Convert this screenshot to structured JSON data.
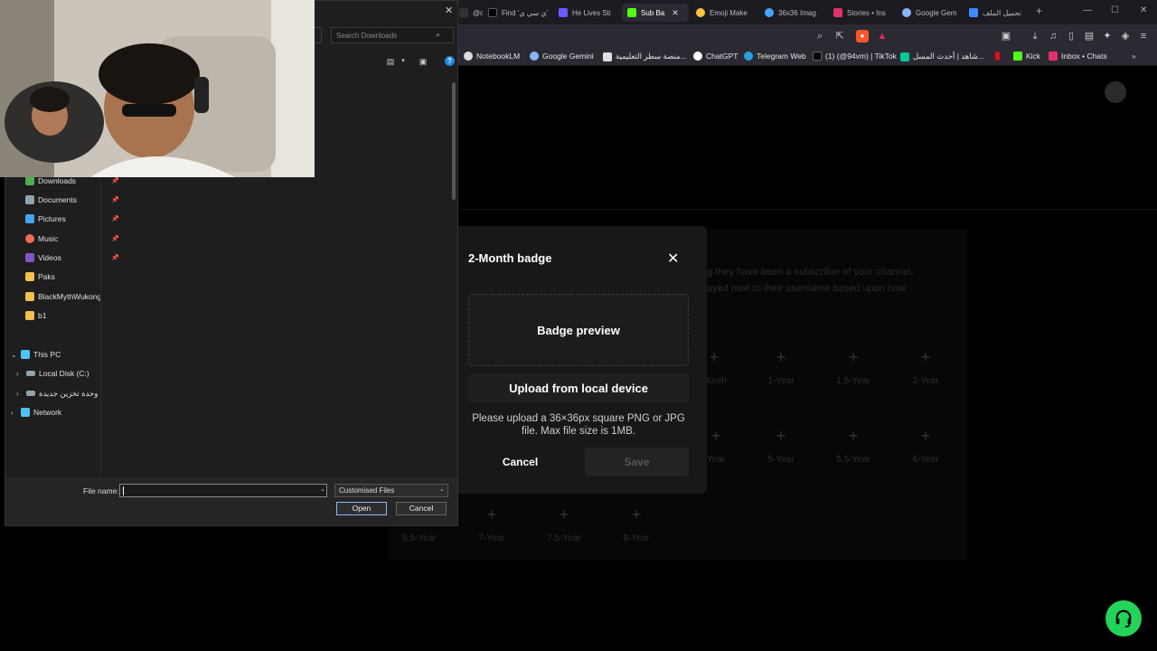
{
  "tabs": [
    {
      "label": "@oli",
      "icon_color": "#333333"
    },
    {
      "label": "Find 'ي سي ي'",
      "icon_color": "#000000"
    },
    {
      "label": "He Lives Sti",
      "icon_color": "#6a5cff"
    },
    {
      "label": "Sub Ba",
      "icon_color": "#53fc18",
      "active": true,
      "close": "✕"
    },
    {
      "label": "Emoji Make",
      "icon_color": "#f4c542"
    },
    {
      "label": "36x36 Imag",
      "icon_color": "#4aa3ff"
    },
    {
      "label": "Stories • Ins",
      "icon_color": "#e1306c"
    },
    {
      "label": "Google Gem",
      "icon_color": "#8ab4f8"
    },
    {
      "label": "تحميل الملف",
      "icon_color": "#3d8bfd"
    }
  ],
  "new_tab": "+",
  "window_controls": [
    "—",
    "☐",
    "✕"
  ],
  "bookmarks": [
    {
      "label": "NotebookLM",
      "icon_color": "#ffffff"
    },
    {
      "label": "Google Gemini",
      "icon_color": "#8ab4f8"
    },
    {
      "label": "منصة سطر التعليمية...",
      "icon_color": "#e0e0e0"
    },
    {
      "label": "ChatGPT",
      "icon_color": "#ffffff"
    },
    {
      "label": "Telegram Web",
      "icon_color": "#2aa1da"
    },
    {
      "label": "(1) (@94vm) | TikTok",
      "icon_color": "#000000"
    },
    {
      "label": "شاهد | أحدث المسل...",
      "icon_color": "#00c896"
    },
    {
      "label": "",
      "icon_color": "#e50914"
    },
    {
      "label": "Kick",
      "icon_color": "#53fc18"
    },
    {
      "label": "Inbox • Chats",
      "icon_color": "#e1306c"
    }
  ],
  "file_dialog": {
    "close": "✕",
    "search_placeholder": "Search Downloads",
    "nav_items": [
      {
        "label": "Downloads",
        "icon_color": "#4caf50",
        "pinned": true
      },
      {
        "label": "Documents",
        "icon_color": "#90a4ae",
        "pinned": true
      },
      {
        "label": "Pictures",
        "icon_color": "#42a5f5",
        "pinned": true
      },
      {
        "label": "Music",
        "icon_color": "#ef6c5a",
        "pinned": true
      },
      {
        "label": "Videos",
        "icon_color": "#7e57c2",
        "pinned": true
      },
      {
        "label": "Paks",
        "icon_color": "#f2c14e",
        "pinned": false
      },
      {
        "label": "BlackMythWukong",
        "icon_color": "#f2c14e",
        "pinned": false
      },
      {
        "label": "b1",
        "icon_color": "#f2c14e",
        "pinned": false
      }
    ],
    "tree_items": [
      {
        "label": "This PC",
        "chevron": "⌄",
        "icon_color": "#4fc3f7"
      },
      {
        "label": "Local Disk (C:)",
        "chevron": "›",
        "icon_color": "#90a4ae"
      },
      {
        "label": "وحدة تخزين جديدة",
        "chevron": "›",
        "icon_color": "#90a4ae"
      },
      {
        "label": "Network",
        "chevron": "›",
        "icon_color": "#4fc3f7"
      }
    ],
    "file_name_label": "File name:",
    "file_name_value": "",
    "file_type": "Customised Files",
    "open_label": "Open",
    "cancel_label": "Cancel"
  },
  "page": {
    "description_line1": "g they have been a subscriber of your channel.",
    "description_line2": "ayed next to their username based upon how",
    "badge_slots": [
      {
        "label": "Month"
      },
      {
        "label": "1-Year"
      },
      {
        "label": "1.5-Year"
      },
      {
        "label": "2-Year"
      },
      {
        "label": "Year"
      },
      {
        "label": "5-Year"
      },
      {
        "label": "5.5-Year"
      },
      {
        "label": "6-Year"
      },
      {
        "label": "6.5-Year"
      },
      {
        "label": "7-Year"
      },
      {
        "label": "7.5-Year"
      },
      {
        "label": "8-Year"
      }
    ]
  },
  "modal": {
    "title": "2-Month badge",
    "close": "✕",
    "preview_label": "Badge preview",
    "upload_label": "Upload from local device",
    "hint": "Please upload a 36×36px square PNG or JPG file. Max file size is 1MB.",
    "cancel_label": "Cancel",
    "save_label": "Save"
  },
  "colors": {
    "accent": "#24d35a",
    "modal_bg": "#181818",
    "page_bg": "#000000"
  }
}
